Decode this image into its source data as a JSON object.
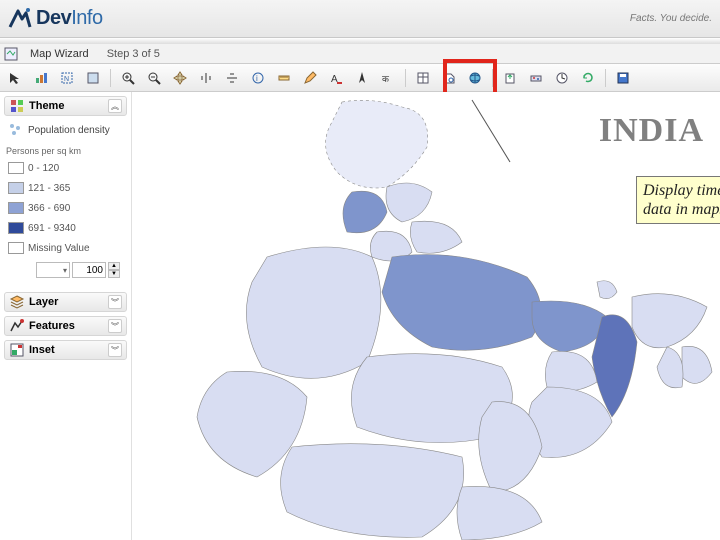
{
  "app": {
    "logo_main": "Dev",
    "logo_sub": "Info",
    "tagline": "Facts. You decide."
  },
  "tab": {
    "title": "Map Wizard",
    "step": "Step 3 of 5"
  },
  "map": {
    "title": "INDIA"
  },
  "callout": {
    "text": "Display time series of data in maps"
  },
  "colors": {
    "legend": [
      "#ffffff",
      "#c5d0e8",
      "#8ea2d4",
      "#5e73b9",
      "#2f4a9a",
      "#ffffff"
    ]
  },
  "sidebar": {
    "theme": {
      "label": "Theme",
      "indicator": "Population density",
      "unit_caption": "Persons per sq km",
      "legend": [
        {
          "range": "0 - 120"
        },
        {
          "range": "121 - 365"
        },
        {
          "range": "366 - 690"
        },
        {
          "range": "691 - 9340"
        },
        {
          "range": "Missing Value"
        }
      ],
      "opacity_value": "100"
    },
    "layer": {
      "label": "Layer"
    },
    "features": {
      "label": "Features"
    },
    "inset": {
      "label": "Inset"
    }
  },
  "toolbar": {
    "icons": [
      "pointer-icon",
      "theme-icon",
      "selection-icon",
      "zoom-extent-icon",
      "zoom-in-icon",
      "zoom-out-icon",
      "pan-icon",
      "fit-width-icon",
      "fit-height-icon",
      "identify-icon",
      "measure-icon",
      "annotate-icon",
      "text-label-icon",
      "north-arrow-icon",
      "graph-icon",
      "table-icon",
      "preview-icon",
      "globe-icon",
      "export-icon",
      "timeline-icon",
      "clock-icon",
      "refresh-icon",
      "save-map-icon"
    ]
  }
}
